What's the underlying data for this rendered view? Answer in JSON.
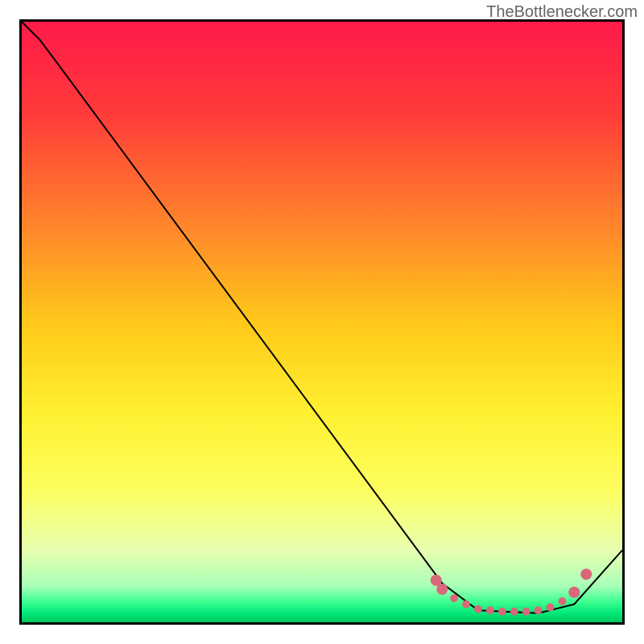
{
  "watermark": "TheBottlenecker.com",
  "chart_data": {
    "type": "line",
    "title": "",
    "xlabel": "",
    "ylabel": "",
    "xlim": [
      0,
      100
    ],
    "ylim": [
      0,
      100
    ],
    "series": [
      {
        "name": "curve",
        "x": [
          0,
          3,
          6,
          70,
          76,
          86,
          92,
          100
        ],
        "y": [
          100,
          97,
          93,
          6.5,
          2,
          1.5,
          3,
          12
        ],
        "color": "#000000"
      },
      {
        "name": "markers",
        "x": [
          69,
          70,
          72,
          74,
          76,
          78,
          80,
          82,
          84,
          86,
          88,
          90,
          92,
          94
        ],
        "y": [
          7,
          5.5,
          4,
          3,
          2.2,
          2,
          1.8,
          1.8,
          1.8,
          2,
          2.5,
          3.5,
          5,
          8
        ],
        "color": "#d9677a",
        "marker": "circle"
      }
    ],
    "gradient_stops": [
      {
        "offset": 0,
        "color": "#ff1a4a"
      },
      {
        "offset": 0.15,
        "color": "#ff3a3a"
      },
      {
        "offset": 0.35,
        "color": "#ff8a2a"
      },
      {
        "offset": 0.5,
        "color": "#ffc81a"
      },
      {
        "offset": 0.65,
        "color": "#fff030"
      },
      {
        "offset": 0.78,
        "color": "#fdff60"
      },
      {
        "offset": 0.88,
        "color": "#e8ffb0"
      },
      {
        "offset": 0.94,
        "color": "#a8ffb8"
      },
      {
        "offset": 0.965,
        "color": "#40ff90"
      },
      {
        "offset": 0.985,
        "color": "#00e878"
      },
      {
        "offset": 1,
        "color": "#00c860"
      }
    ]
  }
}
